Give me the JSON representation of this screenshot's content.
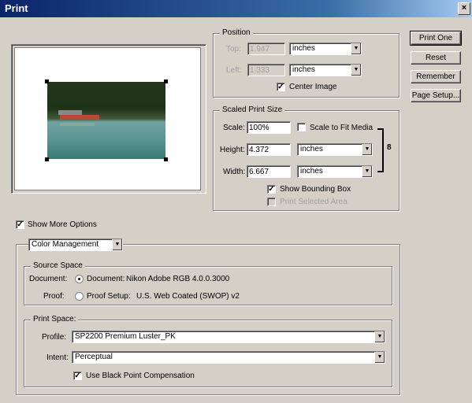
{
  "window": {
    "title": "Print",
    "close_glyph": "×"
  },
  "buttons": {
    "print_one": "Print One",
    "reset": "Reset",
    "remember": "Remember",
    "page_setup": "Page Setup..."
  },
  "position": {
    "legend": "Position",
    "top_label": "Top:",
    "top_value": "1.947",
    "top_unit": "inches",
    "left_label": "Left:",
    "left_value": "1.333",
    "left_unit": "inches",
    "center_image_label": "Center Image",
    "center_image_checked": true
  },
  "scaled": {
    "legend": "Scaled Print Size",
    "scale_label": "Scale:",
    "scale_value": "100%",
    "scale_to_fit_label": "Scale to Fit Media",
    "height_label": "Height:",
    "height_value": "4.372",
    "height_unit": "inches",
    "width_label": "Width:",
    "width_value": "6.667",
    "width_unit": "inches",
    "link_glyph": "8",
    "show_bounding_box_label": "Show Bounding Box",
    "print_selected_area_label": "Print Selected Area"
  },
  "more": {
    "show_more_options_label": "Show More Options",
    "dropdown_value": "Color Management"
  },
  "source": {
    "legend": "Source Space",
    "document_label": "Document:",
    "document_option": "Document:",
    "document_profile": "Nikon Adobe RGB 4.0.0.3000",
    "proof_label": "Proof:",
    "proof_option": "Proof Setup:",
    "proof_profile": "U.S. Web Coated (SWOP) v2"
  },
  "print_space": {
    "legend": "Print Space:",
    "profile_label": "Profile:",
    "profile_value": "SP2200 Premium Luster_PK",
    "intent_label": "Intent:",
    "intent_value": "Perceptual",
    "black_point_label": "Use Black Point Compensation"
  },
  "colors": {
    "title_bar_start": "#0a246a",
    "dialog_bg": "#d4d0c8",
    "preview_bg": "#ffffff"
  }
}
